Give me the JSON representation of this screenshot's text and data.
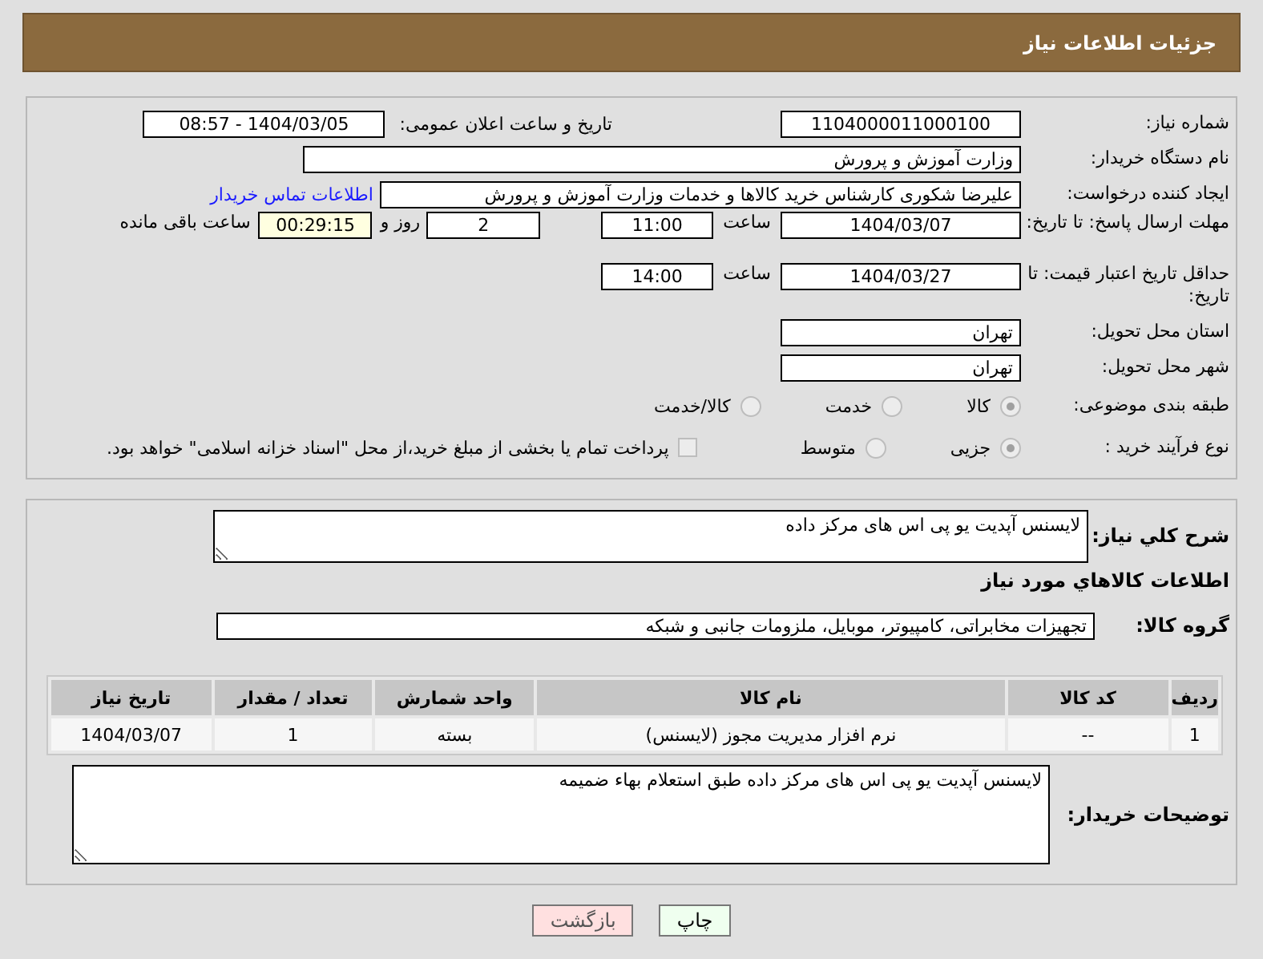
{
  "header": {
    "title": "جزئیات اطلاعات نیاز"
  },
  "need_number": {
    "label": "شماره نیاز:",
    "value": "1104000011000100"
  },
  "announce": {
    "label": "تاریخ و ساعت اعلان عمومی:",
    "value": "1404/03/05 - 08:57"
  },
  "buyer_org": {
    "label": "نام دستگاه خریدار:",
    "value": "وزارت آموزش و پرورش"
  },
  "requester": {
    "label": "ایجاد کننده درخواست:",
    "value": "علیرضا شکوری کارشناس خرید کالاها و خدمات وزارت آموزش و پرورش",
    "link": "اطلاعات تماس خریدار"
  },
  "reply_deadline": {
    "label": "مهلت ارسال پاسخ: تا تاریخ:",
    "date": "1404/03/07",
    "time_label": "ساعت",
    "time": "11:00",
    "days": "2",
    "days_label": "روز و",
    "remaining": "00:29:15",
    "remaining_label": "ساعت باقی مانده"
  },
  "price_validity": {
    "label": "حداقل تاریخ اعتبار قیمت: تا تاریخ:",
    "date": "1404/03/27",
    "time_label": "ساعت",
    "time": "14:00"
  },
  "province": {
    "label": "استان محل تحویل:",
    "value": "تهران"
  },
  "city": {
    "label": "شهر محل تحویل:",
    "value": "تهران"
  },
  "category": {
    "label": "طبقه بندی موضوعی:",
    "options": [
      {
        "label": "کالا",
        "selected": true
      },
      {
        "label": "خدمت",
        "selected": false
      },
      {
        "label": "کالا/خدمت",
        "selected": false
      }
    ]
  },
  "process": {
    "label": "نوع فرآیند خرید :",
    "options": [
      {
        "label": "جزیی",
        "selected": true
      },
      {
        "label": "متوسط",
        "selected": false
      }
    ],
    "payment_note": {
      "checked": false,
      "text": "پرداخت تمام یا بخشی از مبلغ خرید،از محل \"اسناد خزانه اسلامی\" خواهد بود."
    }
  },
  "description": {
    "label": "شرح كلي نياز:",
    "value": "لایسنس آپدیت یو پی اس های مرکز داده"
  },
  "goods_heading": "اطلاعات كالاهاي مورد نياز",
  "goods_group": {
    "label": "گروه کالا:",
    "value": "تجهیزات مخابراتی، کامپیوتر، موبایل، ملزومات جانبی و شبکه"
  },
  "table": {
    "columns": [
      "ردیف",
      "کد کالا",
      "نام کالا",
      "واحد شمارش",
      "تعداد / مقدار",
      "تاریخ نیاز"
    ],
    "rows": [
      [
        "1",
        "--",
        "نرم افزار مدیریت مجوز (لایسنس)",
        "بسته",
        "1",
        "1404/03/07"
      ]
    ]
  },
  "buyer_notes": {
    "label": "توضیحات خریدار:",
    "value": "لایسنس آپدیت یو پی اس های مرکز داده طبق استعلام بهاء ضمیمه"
  },
  "buttons": [
    {
      "label": "چاپ",
      "kind": "print"
    },
    {
      "label": "بازگشت",
      "kind": "back"
    }
  ]
}
